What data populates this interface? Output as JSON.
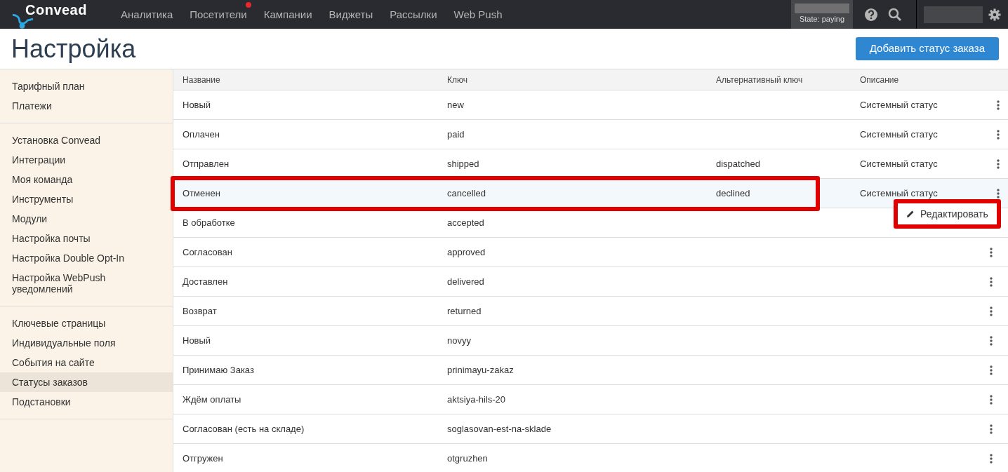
{
  "topbar": {
    "logo": "Convead",
    "nav": [
      {
        "label": "Аналитика",
        "badge": false
      },
      {
        "label": "Посетители",
        "badge": true
      },
      {
        "label": "Кампании",
        "badge": false
      },
      {
        "label": "Виджеты",
        "badge": false
      },
      {
        "label": "Рассылки",
        "badge": false
      },
      {
        "label": "Web Push",
        "badge": false
      }
    ],
    "state": "State: paying"
  },
  "page": {
    "title": "Настройка",
    "add_button": "Добавить статус заказа"
  },
  "sidebar": {
    "groups": [
      [
        {
          "label": "Тарифный план",
          "selected": false
        },
        {
          "label": "Платежи",
          "selected": false
        }
      ],
      [
        {
          "label": "Установка Convead",
          "selected": false
        },
        {
          "label": "Интеграции",
          "selected": false
        },
        {
          "label": "Моя команда",
          "selected": false
        },
        {
          "label": "Инструменты",
          "selected": false
        },
        {
          "label": "Модули",
          "selected": false
        },
        {
          "label": "Настройка почты",
          "selected": false
        },
        {
          "label": "Настройка Double Opt-In",
          "selected": false
        },
        {
          "label": "Настройка WebPush уведомлений",
          "selected": false
        }
      ],
      [
        {
          "label": "Ключевые страницы",
          "selected": false
        },
        {
          "label": "Индивидуальные поля",
          "selected": false
        },
        {
          "label": "События на сайте",
          "selected": false
        },
        {
          "label": "Статусы заказов",
          "selected": true
        },
        {
          "label": "Подстановки",
          "selected": false
        }
      ]
    ]
  },
  "table": {
    "columns": [
      "Название",
      "Ключ",
      "Альтернативный ключ",
      "Описание"
    ],
    "rows": [
      {
        "name": "Новый",
        "key": "new",
        "alt_key": "",
        "description": "Системный статус",
        "selected": false
      },
      {
        "name": "Оплачен",
        "key": "paid",
        "alt_key": "",
        "description": "Системный статус",
        "selected": false
      },
      {
        "name": "Отправлен",
        "key": "shipped",
        "alt_key": "dispatched",
        "description": "Системный статус",
        "selected": false
      },
      {
        "name": "Отменен",
        "key": "cancelled",
        "alt_key": "declined",
        "description": "Системный статус",
        "selected": true
      },
      {
        "name": "В обработке",
        "key": "accepted",
        "alt_key": "",
        "description": "",
        "selected": false
      },
      {
        "name": "Согласован",
        "key": "approved",
        "alt_key": "",
        "description": "",
        "selected": false
      },
      {
        "name": "Доставлен",
        "key": "delivered",
        "alt_key": "",
        "description": "",
        "selected": false
      },
      {
        "name": "Возврат",
        "key": "returned",
        "alt_key": "",
        "description": "",
        "selected": false
      },
      {
        "name": "Новый",
        "key": "novyy",
        "alt_key": "",
        "description": "",
        "selected": false
      },
      {
        "name": "Принимаю Заказ",
        "key": "prinimayu-zakaz",
        "alt_key": "",
        "description": "",
        "selected": false
      },
      {
        "name": "Ждём оплаты",
        "key": "aktsiya-hils-20",
        "alt_key": "",
        "description": "",
        "selected": false
      },
      {
        "name": "Согласован (есть на складе)",
        "key": "soglasovan-est-na-sklade",
        "alt_key": "",
        "description": "",
        "selected": false
      },
      {
        "name": "Отгружен",
        "key": "otgruzhen",
        "alt_key": "",
        "description": "",
        "selected": false
      }
    ]
  },
  "row_menu": {
    "item": "Редактировать"
  }
}
